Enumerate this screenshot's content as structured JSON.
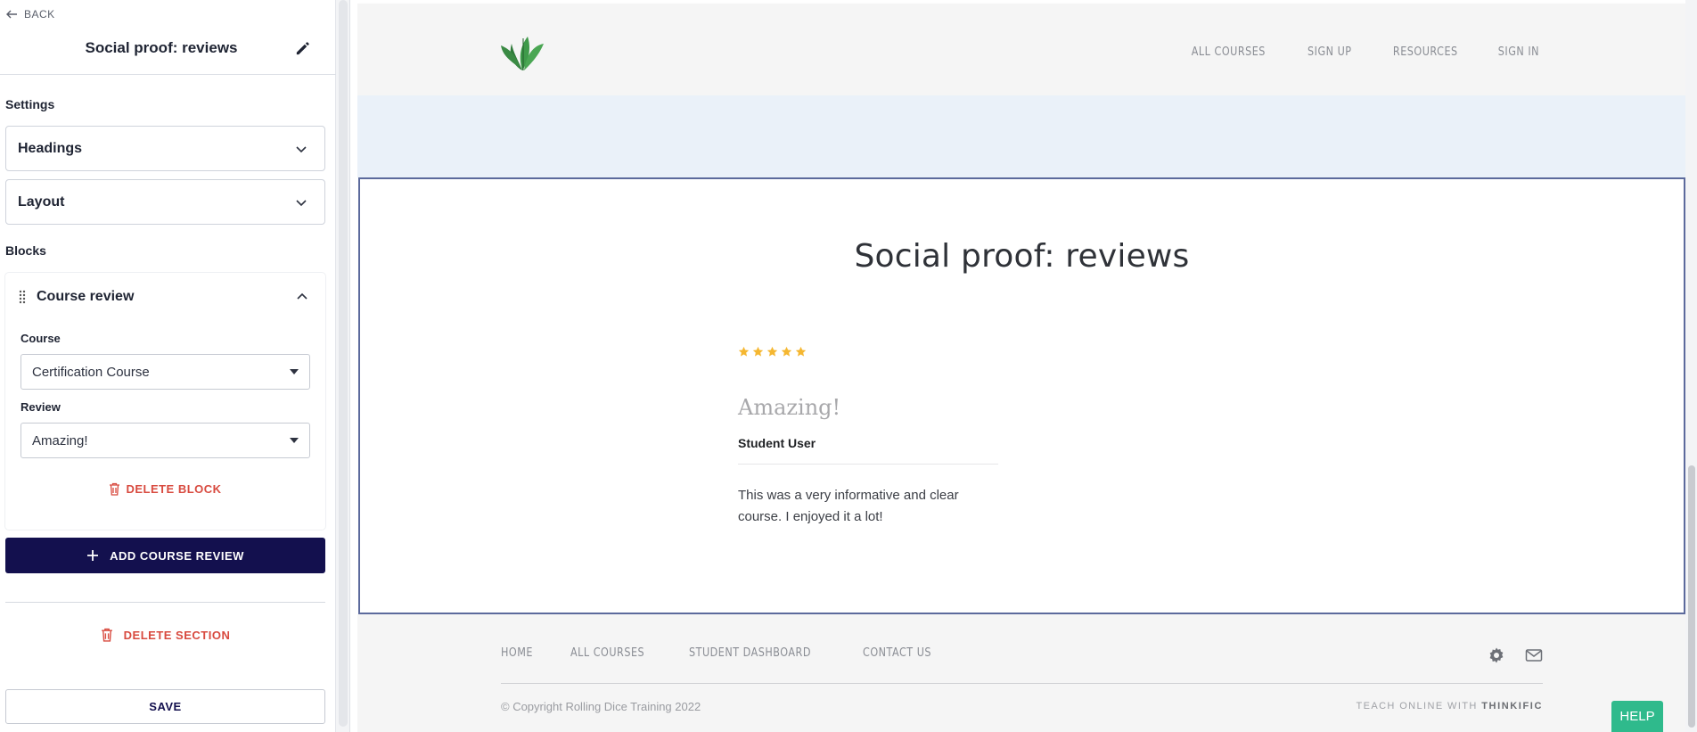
{
  "sidebar": {
    "back_label": "BACK",
    "title": "Social proof: reviews",
    "settings_label": "Settings",
    "accordions": [
      {
        "label": "Headings"
      },
      {
        "label": "Layout"
      }
    ],
    "blocks_label": "Blocks",
    "block": {
      "title": "Course review",
      "course_label": "Course",
      "course_value": "Certification Course",
      "review_label": "Review",
      "review_value": "Amazing!",
      "delete_label": "DELETE BLOCK"
    },
    "add_label": "ADD COURSE REVIEW",
    "delete_section_label": "DELETE SECTION",
    "save_label": "SAVE"
  },
  "preview": {
    "nav": [
      "ALL COURSES",
      "SIGN UP",
      "RESOURCES",
      "SIGN IN"
    ],
    "section_title": "Social proof: reviews",
    "review": {
      "rating": 5,
      "title": "Amazing!",
      "author": "Student User",
      "body": "This was a very informative and clear course. I enjoyed it a lot!"
    },
    "footer_nav": [
      "HOME",
      "ALL COURSES",
      "STUDENT DASHBOARD",
      "CONTACT US"
    ],
    "copyright": "© Copyright Rolling Dice Training 2022",
    "powered_prefix": "TEACH ONLINE WITH",
    "powered_brand": "THINKIFIC",
    "help_label": "HELP"
  },
  "colors": {
    "primary_button": "#13104e",
    "danger": "#d84a3f",
    "section_outline": "#5c6a9c",
    "hero_band": "#eaf1f9",
    "star": "#f5b731",
    "help": "#2fba8c"
  },
  "icons": [
    "arrow-left-icon",
    "pencil-icon",
    "chevron-down-icon",
    "chevron-up-icon",
    "drag-handle-icon",
    "trash-icon",
    "plus-icon",
    "leaf-logo",
    "star-icon",
    "gear-icon",
    "mail-icon",
    "caret-down-icon"
  ]
}
